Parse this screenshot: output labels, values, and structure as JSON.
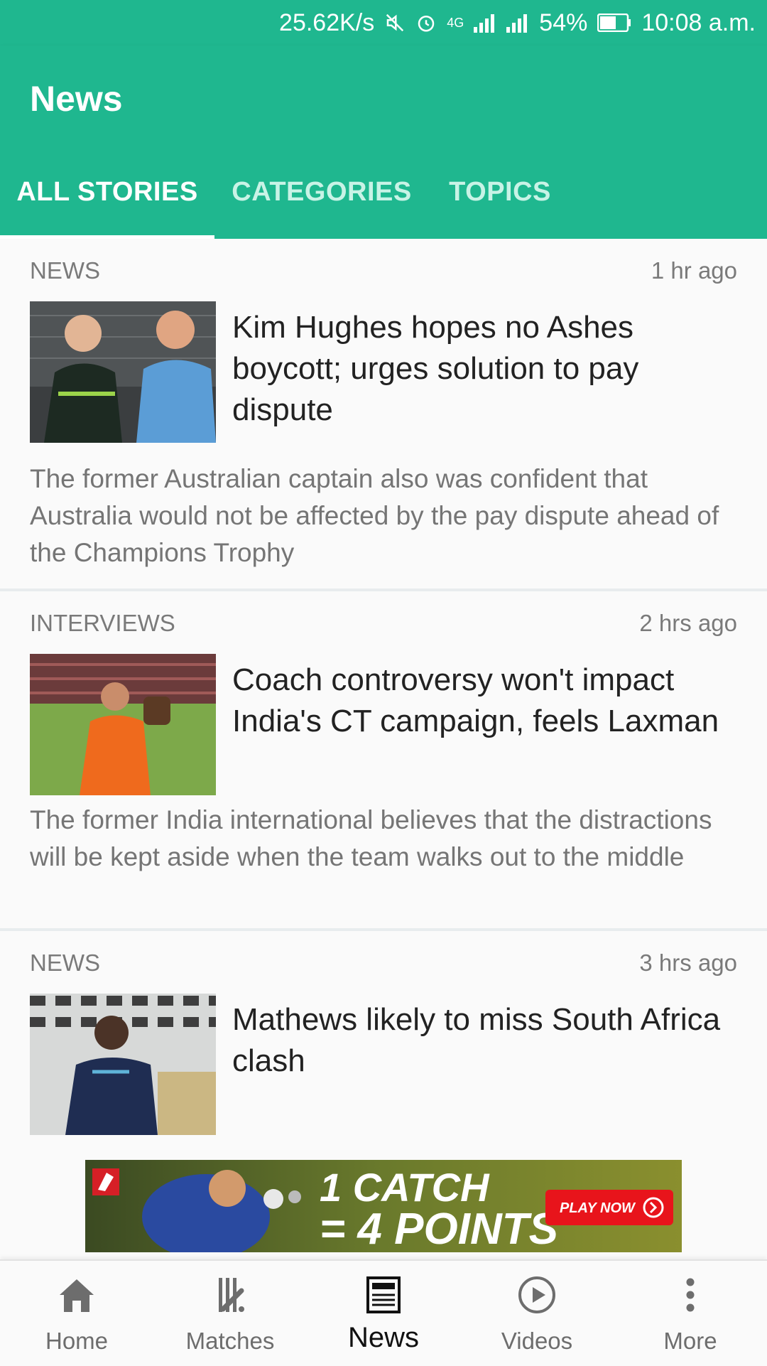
{
  "status_bar": {
    "speed": "25.62K/s",
    "network": "4G",
    "battery": "54%",
    "time": "10:08 a.m."
  },
  "header": {
    "title": "News"
  },
  "tabs": [
    {
      "label": "ALL STORIES",
      "active": true
    },
    {
      "label": "CATEGORIES",
      "active": false
    },
    {
      "label": "TOPICS",
      "active": false
    }
  ],
  "articles": [
    {
      "category": "NEWS",
      "time": "1 hr ago",
      "headline": "Kim Hughes hopes no Ashes boycott; urges solution to pay dispute",
      "summary": "The former Australian captain also was confident that Australia would not be affected by the pay dispute ahead of the Champions Trophy"
    },
    {
      "category": "INTERVIEWS",
      "time": "2 hrs ago",
      "headline": "Coach controversy won't impact India's CT campaign, feels Laxman",
      "summary": "The former India international believes that the distractions will be kept aside when the team walks out to the middle"
    },
    {
      "category": "NEWS",
      "time": "3 hrs ago",
      "headline": "Mathews likely to miss South Africa clash",
      "summary": ""
    }
  ],
  "ad": {
    "line1": "1 CATCH",
    "line2": "= 4 POINTS",
    "cta": "PLAY NOW"
  },
  "bottom_nav": [
    {
      "label": "Home",
      "icon": "home-icon"
    },
    {
      "label": "Matches",
      "icon": "cricket-stumps-icon"
    },
    {
      "label": "News",
      "icon": "newspaper-icon",
      "active": true
    },
    {
      "label": "Videos",
      "icon": "play-circle-icon"
    },
    {
      "label": "More",
      "icon": "more-vertical-icon"
    }
  ],
  "colors": {
    "primary": "#1fb78f",
    "ad_cta": "#e8141b"
  }
}
